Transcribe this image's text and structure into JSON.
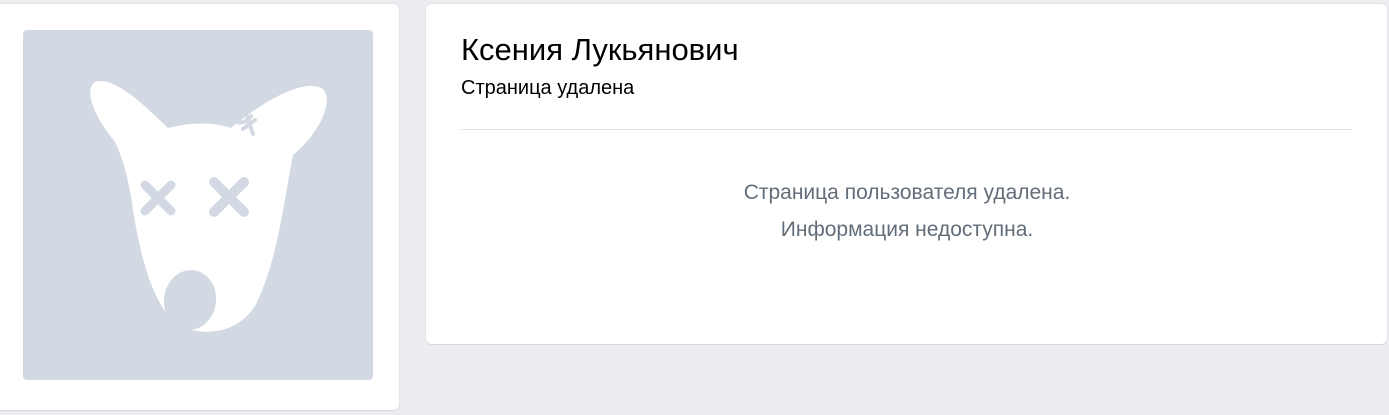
{
  "profile": {
    "name": "Ксения Лукьянович",
    "status": "Страница удалена"
  },
  "deleted_notice": {
    "line1": "Страница пользователя удалена.",
    "line2": "Информация недоступна."
  },
  "avatar": {
    "icon": "deleted-dog-icon"
  },
  "colors": {
    "background": "#ebedf0",
    "card": "#ffffff",
    "avatar_bg": "#d3d9e2",
    "notice_text": "#626d7a"
  }
}
